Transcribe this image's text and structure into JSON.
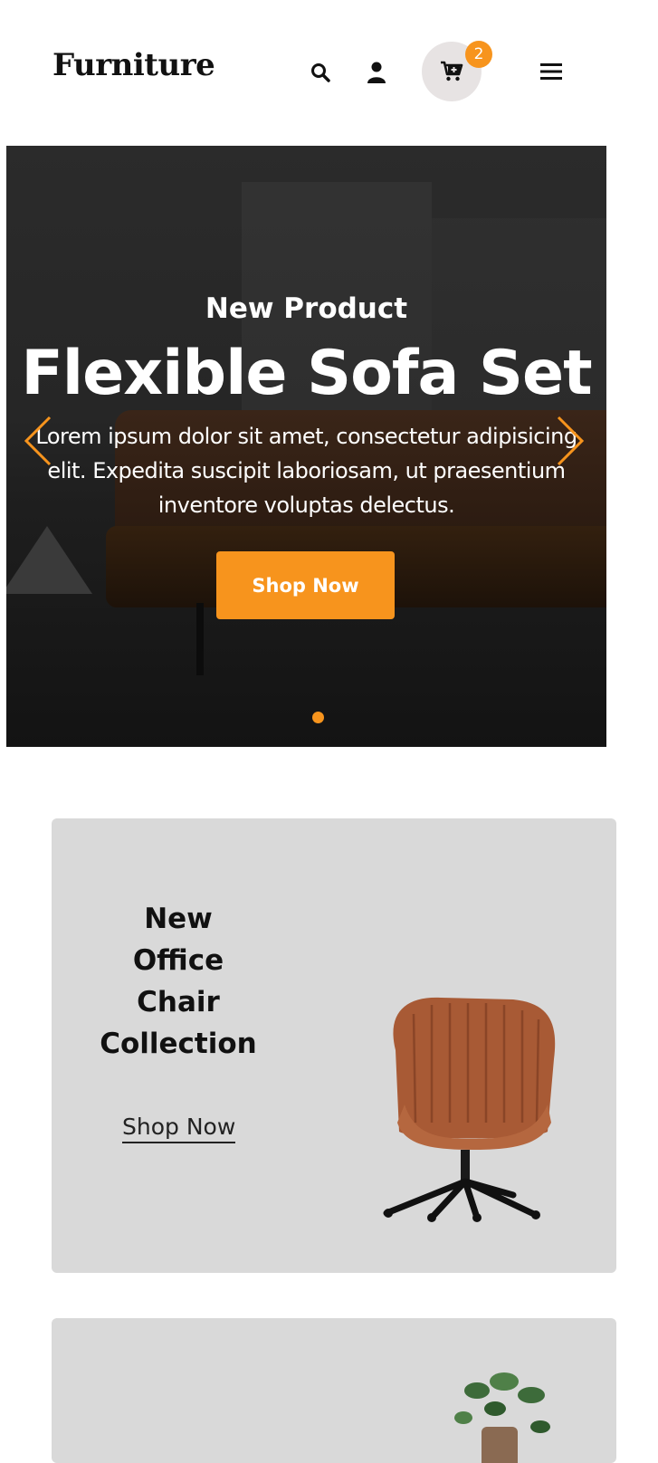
{
  "header": {
    "logo": "Furniture",
    "cart_count": "2",
    "icons": [
      "search-icon",
      "user-icon",
      "cart-icon",
      "menu-icon"
    ]
  },
  "hero": {
    "subtitle": "New Product",
    "title": "Flexible Sofa Set",
    "description": "Lorem ipsum dolor sit amet, consectetur adipisicing elit. Expedita suscipit laboriosam, ut praesentium inventore voluptas delectus.",
    "cta_label": "Shop Now"
  },
  "promos": [
    {
      "title": "New Office Chair Collection",
      "link_label": "Shop Now"
    }
  ],
  "colors": {
    "accent": "#f7941d",
    "card_bg": "#d9d9d9",
    "cart_bg": "#e7e3e3"
  }
}
